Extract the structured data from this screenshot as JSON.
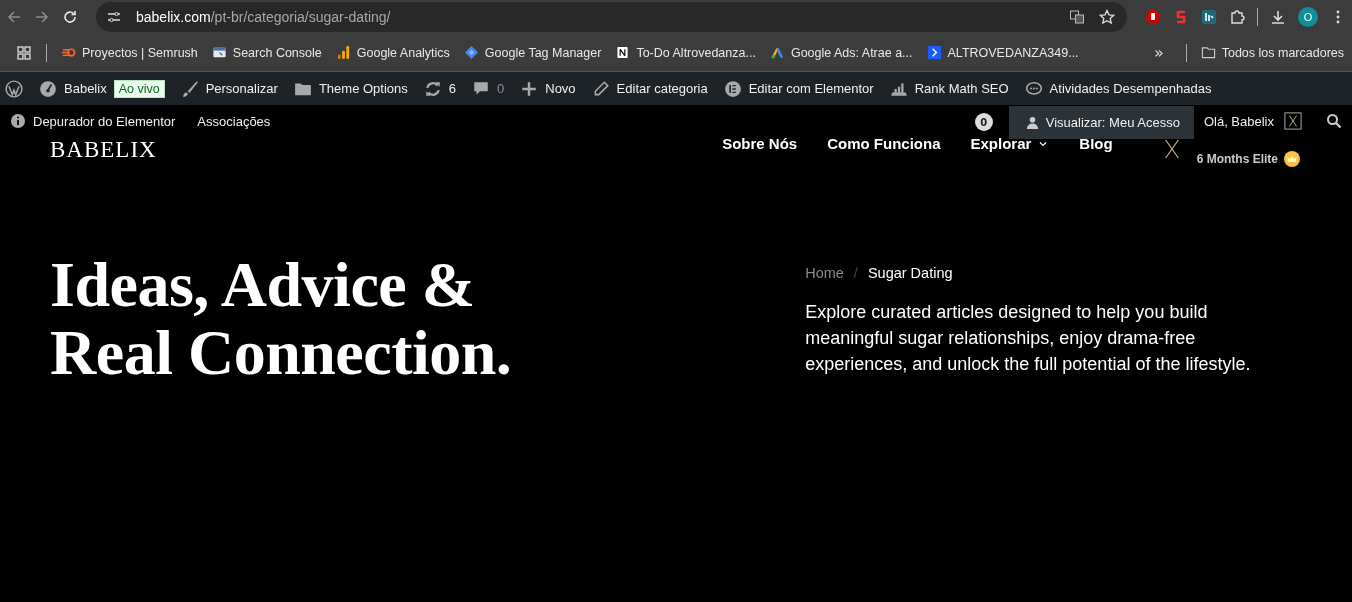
{
  "browser": {
    "url_host": "babelix.com",
    "url_path": "/pt-br/categoria/sugar-dating/",
    "profile_initial": "O",
    "bookmarks": [
      {
        "kind": "semrush",
        "label": "Proyectos | Semrush"
      },
      {
        "kind": "console",
        "label": "Search Console"
      },
      {
        "kind": "analytics",
        "label": "Google Analytics"
      },
      {
        "kind": "tagmanager",
        "label": "Google Tag Manager"
      },
      {
        "kind": "notion",
        "label": "To-Do Altrovedanza..."
      },
      {
        "kind": "ads",
        "label": "Google Ads: Atrae a..."
      },
      {
        "kind": "arrow",
        "label": "ALTROVEDANZA349..."
      }
    ],
    "overflow": "»",
    "all_bookmarks": "Todos los marcadores"
  },
  "admin_bar": {
    "items": [
      {
        "kind": "wp"
      },
      {
        "kind": "site",
        "label": "Babelix",
        "badge": "Ao vivo"
      },
      {
        "kind": "brush",
        "label": "Personalizar"
      },
      {
        "kind": "folder",
        "label": "Theme Options"
      },
      {
        "kind": "updates",
        "label": "6"
      },
      {
        "kind": "comments",
        "label": "0"
      },
      {
        "kind": "plus",
        "label": "Novo"
      },
      {
        "kind": "pencil",
        "label": "Editar categoria"
      },
      {
        "kind": "elementor",
        "label": "Editar com Elementor"
      },
      {
        "kind": "rankmath",
        "label": "Rank Math SEO"
      },
      {
        "kind": "chat",
        "label": "Atividades Desempenhadas"
      }
    ],
    "row2": [
      {
        "kind": "info",
        "label": "Depurador do Elementor"
      },
      {
        "kind": "plain",
        "label": "Associações"
      }
    ],
    "notification_count": "0",
    "dropdown_item": "Visualizar: Meu Acesso",
    "greeting": "Olá, Babelix"
  },
  "site_header": {
    "logo": "BABELIX",
    "nav": [
      {
        "label": "Sobre Nós",
        "has_menu": false
      },
      {
        "label": "Como Funciona",
        "has_menu": false
      },
      {
        "label": "Explorar",
        "has_menu": true
      },
      {
        "label": "Blog",
        "has_menu": false
      }
    ],
    "membership": "6 Months Elite"
  },
  "hero": {
    "title_lines": [
      "Ideas, Advice &",
      "Real Connection."
    ],
    "breadcrumb_separator": "/",
    "breadcrumb": [
      {
        "label": "Home",
        "selected": false
      },
      {
        "label": "Sugar Dating",
        "selected": true
      }
    ],
    "description": "Explore curated articles designed to help you build meaningful sugar relationships, enjoy drama-free experiences, and unlock the full potential of the lifestyle."
  }
}
